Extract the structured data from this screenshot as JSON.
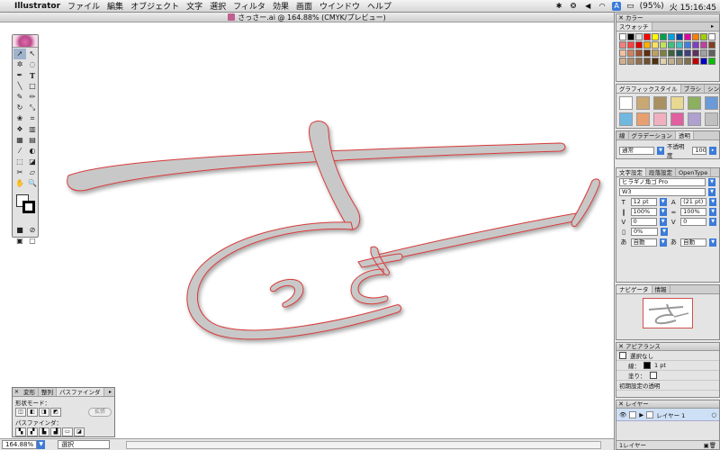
{
  "menubar": {
    "apple": "",
    "app": "Illustrator",
    "items": [
      "ファイル",
      "編集",
      "オブジェクト",
      "文字",
      "選択",
      "フィルタ",
      "効果",
      "画面",
      "ウインドウ",
      "ヘルプ"
    ],
    "battery": "(95%)",
    "clock": "火 15:16:45"
  },
  "document": {
    "title": "さっさー.ai @ 164.88% (CMYK/プレビュー)",
    "zoom": "164.88%",
    "status": "選択"
  },
  "pathfinder": {
    "tabs": [
      "変形",
      "整列",
      "パスファインダ"
    ],
    "shape_modes_label": "形状モード：",
    "expand_label": "拡張",
    "pathfinder_label": "パスファインダ："
  },
  "color_panel": {
    "title": "カラー",
    "tab": "スウォッチ",
    "swatches": [
      "#ffffff",
      "#000000",
      "#e0e0e0",
      "#ff0000",
      "#ffff00",
      "#00a050",
      "#00a0e0",
      "#0040a0",
      "#e000a0",
      "#ff8000",
      "#a0d000",
      "#ffffff",
      "#f08080",
      "#ff4040",
      "#e00000",
      "#ffb000",
      "#ffe060",
      "#c0e060",
      "#40c080",
      "#40c0c0",
      "#4080e0",
      "#8040c0",
      "#c040a0",
      "#804020",
      "#f0c0a0",
      "#d08060",
      "#a05030",
      "#603010",
      "#c0a060",
      "#808040",
      "#406040",
      "#205060",
      "#404080",
      "#603060",
      "#a0a0a0",
      "#606060",
      "#d0b090",
      "#b09070",
      "#907050",
      "#705030",
      "#503010",
      "#e0d0b0",
      "#c0b090",
      "#a09070",
      "#807050",
      "#c00000",
      "#0000c0",
      "#00c000"
    ]
  },
  "graphic_styles": {
    "tabs": [
      "グラフィックスタイル",
      "ブラシ",
      "シンボル"
    ],
    "styles": [
      "#ffffff",
      "#c9a872",
      "#a99060",
      "#e8d890",
      "#8cb060",
      "#6a9ad8",
      "#70b8e0",
      "#e8a070",
      "#f0b0c0",
      "#e060a0",
      "#b0a0d0",
      "#c0c0c0"
    ]
  },
  "transparency_panel": {
    "tabs": [
      "線",
      "グラデーション",
      "透明"
    ],
    "mode": "通常",
    "opacity_label": "不透明度",
    "opacity": "100"
  },
  "character_panel": {
    "tabs": [
      "文字設定",
      "段落設定",
      "OpenType"
    ],
    "font": "ヒラギノ角ゴ Pro",
    "weight": "W3",
    "size": "12 pt",
    "leading": "(21 pt)",
    "vscale": "100%",
    "hscale": "100%",
    "tracking": "0",
    "kerning": "0",
    "tsume": "0%",
    "aki1": "自動",
    "aki2": "自動"
  },
  "navigator": {
    "tabs": [
      "ナビゲータ",
      "情報"
    ]
  },
  "appearance": {
    "title": "アピアランス",
    "selection": "選択なし",
    "stroke_label": "線：",
    "stroke_value": "1 pt",
    "fill_label": "塗り：",
    "default_opacity": "初期設定の透明"
  },
  "layers": {
    "title": "レイヤー",
    "layer_name": "レイヤー 1",
    "footer": "1レイヤー"
  },
  "drawing": {
    "fill": "#c8c8c8",
    "outline": "#d83a3a"
  }
}
